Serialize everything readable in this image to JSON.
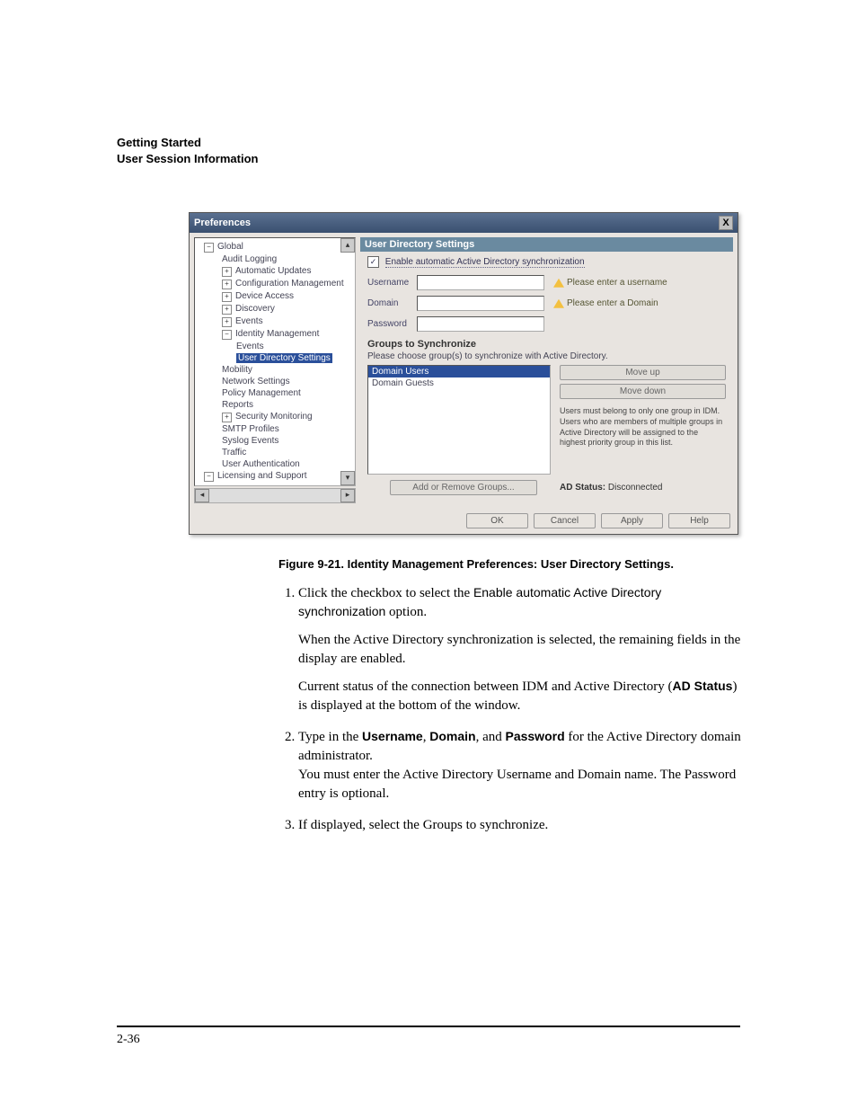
{
  "header": {
    "line1": "Getting Started",
    "line2": "User Session Information"
  },
  "dialog": {
    "title": "Preferences",
    "close": "X",
    "tree": {
      "n0": "Global",
      "n1": "Audit Logging",
      "n2": "Automatic Updates",
      "n3": "Configuration Management",
      "n4": "Device Access",
      "n5": "Discovery",
      "n6": "Events",
      "n7": "Identity Management",
      "n7a": "Events",
      "n7b": "User Directory Settings",
      "n8": "Mobility",
      "n9": "Network Settings",
      "n10": "Policy Management",
      "n11": "Reports",
      "n12": "Security Monitoring",
      "n13": "SMTP Profiles",
      "n14": "Syslog Events",
      "n15": "Traffic",
      "n16": "User Authentication",
      "n17": "Licensing and Support"
    },
    "section_title": "User Directory Settings",
    "checkbox_label": "Enable automatic Active Directory synchronization",
    "checkbox_checked": "✓",
    "username_label": "Username",
    "domain_label": "Domain",
    "password_label": "Password",
    "warn_username": "Please enter a username",
    "warn_domain": "Please enter a Domain",
    "groups_title": "Groups to Synchronize",
    "groups_sub": "Please choose group(s) to synchronize with Active Directory.",
    "group_item1": "Domain Users",
    "group_item2": "Domain Guests",
    "move_up": "Move up",
    "move_down": "Move down",
    "group_help": "Users must belong to only one group in IDM. Users who are members of multiple groups in Active Directory will be assigned to the highest priority group in this list.",
    "add_remove": "Add or Remove Groups...",
    "ad_status_label": "AD Status:",
    "ad_status_value": "Disconnected",
    "ok": "OK",
    "cancel": "Cancel",
    "apply": "Apply",
    "help": "Help"
  },
  "caption": "Figure 9-21. Identity Management Preferences: User Directory Settings.",
  "steps": {
    "s1a": "Click the checkbox to select the ",
    "s1b": "Enable automatic Active Directory synchronization",
    "s1c": " option.",
    "s1d": "When the Active Directory synchronization is selected, the remaining fields in the display are enabled.",
    "s1e": "Current status of the connection between IDM and Active Directory (",
    "s1f": "AD Status",
    "s1g": ") is displayed at the bottom of the window.",
    "s2a": "Type in the ",
    "s2b": "Username",
    "s2c": ", ",
    "s2d": "Domain",
    "s2e": ", and ",
    "s2f": "Password",
    "s2g": " for the Active Directory domain administrator.",
    "s2h": "You must enter the Active Directory Username and Domain name. The Password entry is optional.",
    "s3": "If displayed, select the Groups to synchronize."
  },
  "page_number": "2-36"
}
